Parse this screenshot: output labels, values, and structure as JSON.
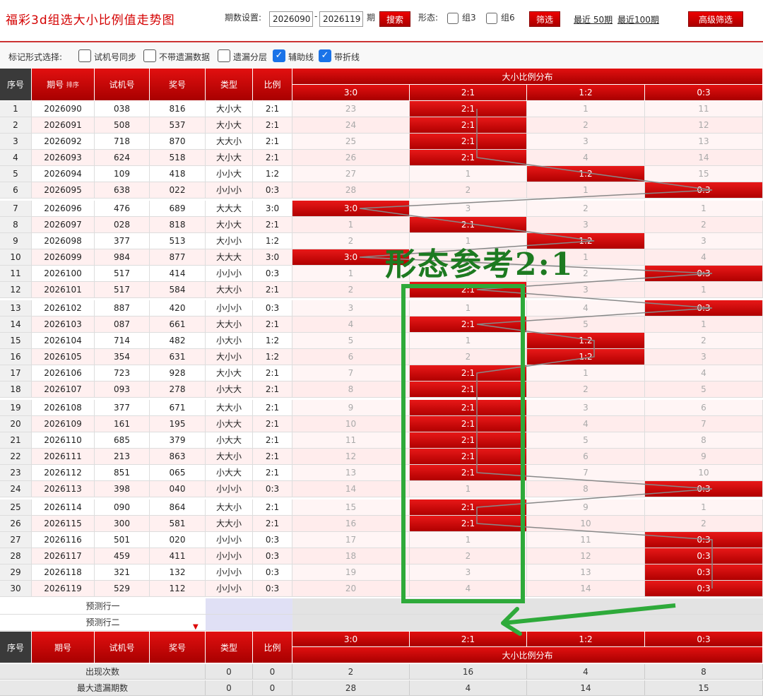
{
  "header": {
    "title": "福彩3d组选大小比例值走势图",
    "period_label": "期数设置:",
    "period_from": "2026090",
    "period_to": "2026119",
    "period_suffix": "期",
    "search_btn": "搜索",
    "shape_label": "形态:",
    "zu3": "组3",
    "zu6": "组6",
    "filter_btn": "筛选",
    "recent50": "最近 50期",
    "recent100": "最近100期",
    "advanced_btn": "高级筛选"
  },
  "markbar": {
    "label": "标记形式选择:",
    "options": [
      {
        "text": "试机号同步",
        "checked": false
      },
      {
        "text": "不带遗漏数据",
        "checked": false
      },
      {
        "text": "遗漏分层",
        "checked": false
      },
      {
        "text": "辅助线",
        "checked": true
      },
      {
        "text": "带折线",
        "checked": true
      }
    ]
  },
  "table_header": {
    "seq": "序号",
    "issue": "期号",
    "sort": "排序",
    "trial": "试机号",
    "prize": "奖号",
    "type": "类型",
    "ratio": "比例",
    "dist": "大小比例分布",
    "cols": [
      "3:0",
      "2:1",
      "1:2",
      "0:3"
    ]
  },
  "rows": [
    {
      "seq": "1",
      "issue": "2026090",
      "trial": "038",
      "prize": "816",
      "type": "大小大",
      "ratio": "2:1",
      "d": [
        "23",
        "2:1",
        "1",
        "11"
      ]
    },
    {
      "seq": "2",
      "issue": "2026091",
      "trial": "508",
      "prize": "537",
      "type": "大小大",
      "ratio": "2:1",
      "d": [
        "24",
        "2:1",
        "2",
        "12"
      ]
    },
    {
      "seq": "3",
      "issue": "2026092",
      "trial": "718",
      "prize": "870",
      "type": "大大小",
      "ratio": "2:1",
      "d": [
        "25",
        "2:1",
        "3",
        "13"
      ]
    },
    {
      "seq": "4",
      "issue": "2026093",
      "trial": "624",
      "prize": "518",
      "type": "大小大",
      "ratio": "2:1",
      "d": [
        "26",
        "2:1",
        "4",
        "14"
      ]
    },
    {
      "seq": "5",
      "issue": "2026094",
      "trial": "109",
      "prize": "418",
      "type": "小小大",
      "ratio": "1:2",
      "d": [
        "27",
        "1",
        "1:2",
        "15"
      ]
    },
    {
      "seq": "6",
      "issue": "2026095",
      "trial": "638",
      "prize": "022",
      "type": "小小小",
      "ratio": "0:3",
      "d": [
        "28",
        "2",
        "1",
        "0:3"
      ]
    },
    {
      "seq": "7",
      "issue": "2026096",
      "trial": "476",
      "prize": "689",
      "type": "大大大",
      "ratio": "3:0",
      "d": [
        "3:0",
        "3",
        "2",
        "1"
      ]
    },
    {
      "seq": "8",
      "issue": "2026097",
      "trial": "028",
      "prize": "818",
      "type": "大小大",
      "ratio": "2:1",
      "d": [
        "1",
        "2:1",
        "3",
        "2"
      ]
    },
    {
      "seq": "9",
      "issue": "2026098",
      "trial": "377",
      "prize": "513",
      "type": "大小小",
      "ratio": "1:2",
      "d": [
        "2",
        "1",
        "1:2",
        "3"
      ]
    },
    {
      "seq": "10",
      "issue": "2026099",
      "trial": "984",
      "prize": "877",
      "type": "大大大",
      "ratio": "3:0",
      "d": [
        "3:0",
        "2",
        "1",
        "4"
      ]
    },
    {
      "seq": "11",
      "issue": "2026100",
      "trial": "517",
      "prize": "414",
      "type": "小小小",
      "ratio": "0:3",
      "d": [
        "1",
        "3",
        "2",
        "0:3"
      ]
    },
    {
      "seq": "12",
      "issue": "2026101",
      "trial": "517",
      "prize": "584",
      "type": "大大小",
      "ratio": "2:1",
      "d": [
        "2",
        "2:1",
        "3",
        "1"
      ]
    },
    {
      "seq": "13",
      "issue": "2026102",
      "trial": "887",
      "prize": "420",
      "type": "小小小",
      "ratio": "0:3",
      "d": [
        "3",
        "1",
        "4",
        "0:3"
      ]
    },
    {
      "seq": "14",
      "issue": "2026103",
      "trial": "087",
      "prize": "661",
      "type": "大大小",
      "ratio": "2:1",
      "d": [
        "4",
        "2:1",
        "5",
        "1"
      ]
    },
    {
      "seq": "15",
      "issue": "2026104",
      "trial": "714",
      "prize": "482",
      "type": "小大小",
      "ratio": "1:2",
      "d": [
        "5",
        "1",
        "1:2",
        "2"
      ]
    },
    {
      "seq": "16",
      "issue": "2026105",
      "trial": "354",
      "prize": "631",
      "type": "大小小",
      "ratio": "1:2",
      "d": [
        "6",
        "2",
        "1:2",
        "3"
      ]
    },
    {
      "seq": "17",
      "issue": "2026106",
      "trial": "723",
      "prize": "928",
      "type": "大小大",
      "ratio": "2:1",
      "d": [
        "7",
        "2:1",
        "1",
        "4"
      ]
    },
    {
      "seq": "18",
      "issue": "2026107",
      "trial": "093",
      "prize": "278",
      "type": "小大大",
      "ratio": "2:1",
      "d": [
        "8",
        "2:1",
        "2",
        "5"
      ]
    },
    {
      "seq": "19",
      "issue": "2026108",
      "trial": "377",
      "prize": "671",
      "type": "大大小",
      "ratio": "2:1",
      "d": [
        "9",
        "2:1",
        "3",
        "6"
      ]
    },
    {
      "seq": "20",
      "issue": "2026109",
      "trial": "161",
      "prize": "195",
      "type": "小大大",
      "ratio": "2:1",
      "d": [
        "10",
        "2:1",
        "4",
        "7"
      ]
    },
    {
      "seq": "21",
      "issue": "2026110",
      "trial": "685",
      "prize": "379",
      "type": "小大大",
      "ratio": "2:1",
      "d": [
        "11",
        "2:1",
        "5",
        "8"
      ]
    },
    {
      "seq": "22",
      "issue": "2026111",
      "trial": "213",
      "prize": "863",
      "type": "大大小",
      "ratio": "2:1",
      "d": [
        "12",
        "2:1",
        "6",
        "9"
      ]
    },
    {
      "seq": "23",
      "issue": "2026112",
      "trial": "851",
      "prize": "065",
      "type": "小大大",
      "ratio": "2:1",
      "d": [
        "13",
        "2:1",
        "7",
        "10"
      ]
    },
    {
      "seq": "24",
      "issue": "2026113",
      "trial": "398",
      "prize": "040",
      "type": "小小小",
      "ratio": "0:3",
      "d": [
        "14",
        "1",
        "8",
        "0:3"
      ]
    },
    {
      "seq": "25",
      "issue": "2026114",
      "trial": "090",
      "prize": "864",
      "type": "大大小",
      "ratio": "2:1",
      "d": [
        "15",
        "2:1",
        "9",
        "1"
      ]
    },
    {
      "seq": "26",
      "issue": "2026115",
      "trial": "300",
      "prize": "581",
      "type": "大大小",
      "ratio": "2:1",
      "d": [
        "16",
        "2:1",
        "10",
        "2"
      ]
    },
    {
      "seq": "27",
      "issue": "2026116",
      "trial": "501",
      "prize": "020",
      "type": "小小小",
      "ratio": "0:3",
      "d": [
        "17",
        "1",
        "11",
        "0:3"
      ]
    },
    {
      "seq": "28",
      "issue": "2026117",
      "trial": "459",
      "prize": "411",
      "type": "小小小",
      "ratio": "0:3",
      "d": [
        "18",
        "2",
        "12",
        "0:3"
      ]
    },
    {
      "seq": "29",
      "issue": "2026118",
      "trial": "321",
      "prize": "132",
      "type": "小小小",
      "ratio": "0:3",
      "d": [
        "19",
        "3",
        "13",
        "0:3"
      ]
    },
    {
      "seq": "30",
      "issue": "2026119",
      "trial": "529",
      "prize": "112",
      "type": "小小小",
      "ratio": "0:3",
      "d": [
        "20",
        "4",
        "14",
        "0:3"
      ]
    }
  ],
  "predict": {
    "row1": "预测行一",
    "row2": "预测行二"
  },
  "footer": {
    "stats": [
      {
        "label": "出现次数",
        "type": "0",
        "ratio": "0",
        "d": [
          "2",
          "16",
          "4",
          "8"
        ]
      },
      {
        "label": "最大遗漏期数",
        "type": "0",
        "ratio": "0",
        "d": [
          "28",
          "4",
          "14",
          "15"
        ]
      }
    ]
  },
  "annotation": {
    "text": "形态参考2:1"
  },
  "colors": {
    "accent": "#c00000",
    "annotation": "#2eaa3a",
    "line": "#888888"
  }
}
